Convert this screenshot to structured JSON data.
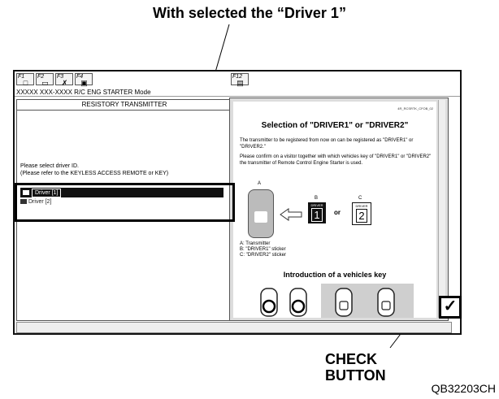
{
  "annotations": {
    "top_caption": "With selected the “Driver 1”",
    "check_label_line1": "CHECK",
    "check_label_line2": "BUTTON",
    "figure_code": "QB32203CH"
  },
  "toolbar": {
    "buttons": [
      {
        "key": "F1",
        "icon": "document-icon",
        "glyph": "□"
      },
      {
        "key": "F2",
        "icon": "car-icon",
        "glyph": "▭"
      },
      {
        "key": "F3",
        "icon": "tools-icon",
        "glyph": "✗"
      },
      {
        "key": "F4",
        "icon": "vehicle-icon",
        "glyph": "▣"
      }
    ],
    "f12": {
      "key": "F12",
      "icon": "print-icon",
      "glyph": "▤"
    }
  },
  "window": {
    "mode_title": "XXXXX XXX-XXXX R/C ENG STARTER Mode"
  },
  "left_panel": {
    "title": "RESISTORY TRANSMITTER",
    "prompt_line1": "Please select driver ID.",
    "prompt_line2": "(Please refer to the KEYLESS ACCESS REMOTE or KEY)",
    "options": [
      {
        "label": "Driver [1]",
        "selected": true
      },
      {
        "label": "Driver [2]",
        "selected": false
      }
    ]
  },
  "document": {
    "code": "4R_RCSRTK_CFOB_02",
    "title": "Selection of \"DRIVER1\" or \"DRIVER2\"",
    "para1": "The transmitter to be registered from now on can be registered as \"DRIVER1\" or \"DRIVER2.\"",
    "para2": "Please confirm on a visitor together with which vehicles key of \"DRIVER1\" or \"DRIVER2\" the transmitter of Remote Control Engine Starter is used.",
    "label_a": "A",
    "label_b": "B",
    "label_c": "C",
    "driver_word": "DRIVER",
    "driver1_num": "1",
    "driver2_num": "2",
    "or_text": "or",
    "legend_a": "A: Transmitter",
    "legend_b": "B: \"DRIVER1\" sticker",
    "legend_c": "C: \"DRIVER2\" sticker",
    "subtitle": "Introduction of a vehicles key"
  },
  "check_button": {
    "glyph": "✓",
    "icon": "check-icon"
  }
}
